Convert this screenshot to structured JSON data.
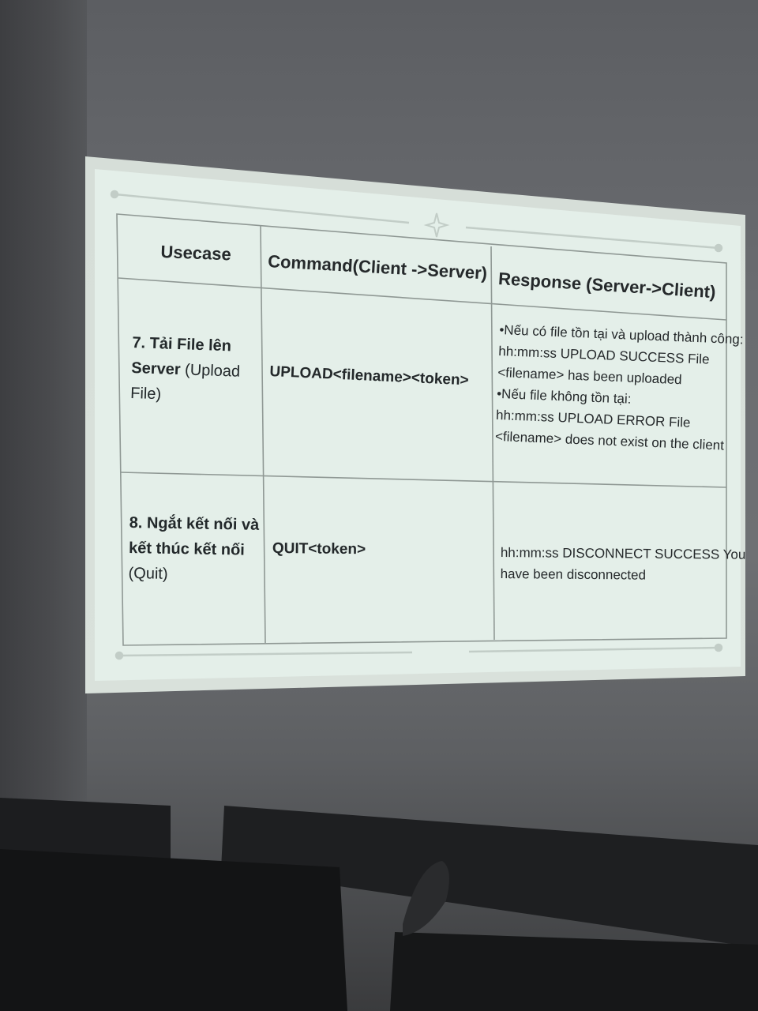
{
  "table": {
    "headers": {
      "usecase": "Usecase",
      "command": "Command(Client ->Server)",
      "response": "Response (Server->Client)"
    },
    "rows": [
      {
        "usecase_bold": "7. Tải File lên",
        "usecase_bold2": "Server",
        "usecase_rest": " (Upload",
        "usecase_rest2": "File)",
        "command": "UPLOAD<filename><token>",
        "response_lines": [
          "•Nếu có file tồn tại và upload thành công:",
          "hh:mm:ss UPLOAD SUCCESS File",
          "<filename> has been uploaded",
          "•Nếu file không tồn tại:",
          "hh:mm:ss UPLOAD ERROR File",
          "<filename> does not exist on the client"
        ]
      },
      {
        "usecase_bold": "8. Ngắt kết nối và",
        "usecase_bold2": "kết thúc kết nối",
        "usecase_rest2": "(Quit)",
        "command": "QUIT<token>",
        "response_lines": [
          "hh:mm:ss DISCONNECT SUCCESS You",
          "have been disconnected"
        ]
      }
    ]
  }
}
